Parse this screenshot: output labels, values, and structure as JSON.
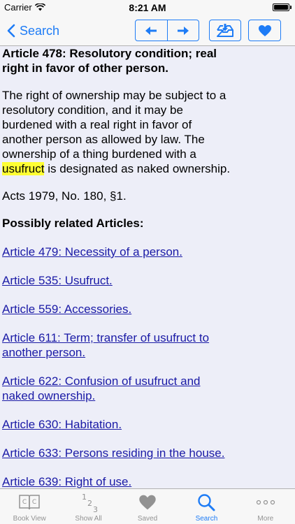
{
  "status_bar": {
    "carrier": "Carrier",
    "time": "8:21 AM"
  },
  "nav": {
    "back_label": "Search"
  },
  "article": {
    "title": "Article 478: Resolutory condition; real right in favor of other person.",
    "body_before": "The right of ownership may be subject to a resolutory condition, and it may be burdened with a real right in favor of another person as allowed by law. The ownership of a thing burdened with a ",
    "highlight": "usufruct",
    "body_after": " is designated as naked ownership.",
    "acts": "Acts 1979, No. 180, §1.",
    "related_heading": "Possibly related Articles:",
    "related": [
      "Article 479: Necessity of a person.",
      "Article 535: Usufruct.",
      "Article 559: Accessories.",
      "Article 611: Term; transfer of usufruct to another person.",
      "Article 622: Confusion of usufruct and naked ownership.",
      "Article 630: Habitation.",
      "Article 633: Persons residing in the house.",
      "Article 639: Right of use."
    ]
  },
  "tabs": [
    {
      "label": "Book View",
      "icon": "book-view-icon"
    },
    {
      "label": "Show All",
      "icon": "numbers-icon"
    },
    {
      "label": "Saved",
      "icon": "heart-icon"
    },
    {
      "label": "Search",
      "icon": "search-icon"
    },
    {
      "label": "More",
      "icon": "more-icon"
    }
  ],
  "colors": {
    "accent": "#1E7CF6",
    "link": "#1A1AA6",
    "highlight": "#FFFF33",
    "background": "#EDEEF8"
  }
}
